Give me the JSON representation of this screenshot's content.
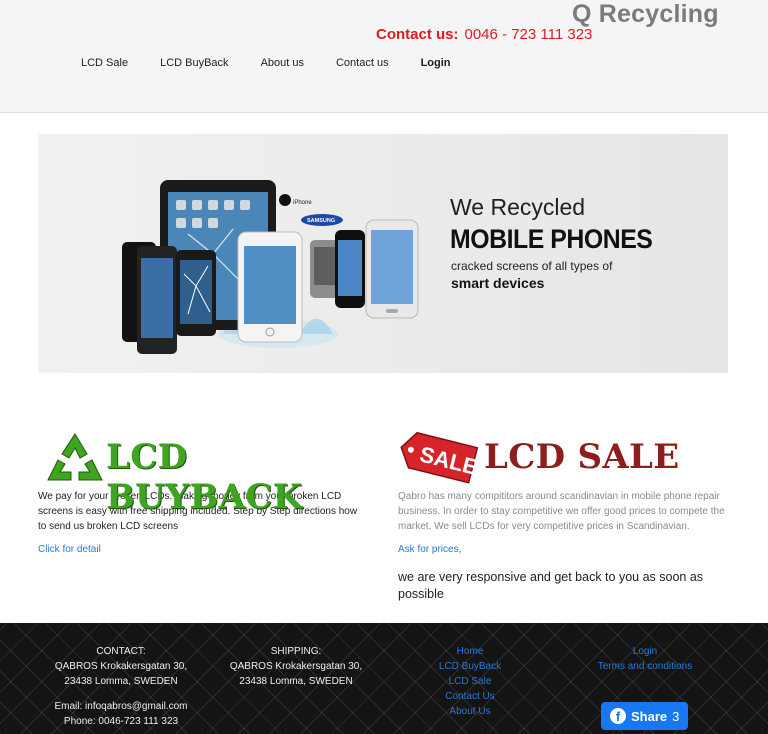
{
  "header": {
    "brand": "Q Recycling",
    "contact_label": "Contact us:",
    "contact_phone": "0046 - 723 111 323",
    "nav": [
      "LCD Sale",
      "LCD BuyBack",
      "About us",
      "Contact us",
      "Login"
    ]
  },
  "banner": {
    "line1": "We Recycled",
    "line2": "MOBILE PHONES",
    "line3": "cracked screens of all types of",
    "line4": "smart devices",
    "brand_iphone": "iPhone",
    "brand_samsung": "SAMSUNG"
  },
  "buyback": {
    "logo_text": "LCD BUYBACK",
    "description": "We pay for your broken LCDs. Making money from your broken LCD screens is easy with free shipping included. Step by Step directions how to send us broken LCD screens",
    "link": "Click for detail"
  },
  "sale": {
    "badge": "SALE",
    "logo_text": "LCD SALE",
    "description": "Qabro has many compititors around scandinavian in mobile phone repair business. In order to stay competitive we offer good prices to compete the market. We sell LCDs for very competitive prices in Scandinavian.",
    "link": "Ask for prices,",
    "note": "we are very responsive and get back to you as soon as possible"
  },
  "footer": {
    "contact": {
      "title": "CONTACT:",
      "line1": "QABROS Krokakersgatan 30,",
      "line2": "23438 Lomma, SWEDEN",
      "email": "Email: infoqabros@gmail.com",
      "phone": "Phone: 0046-723 111 323"
    },
    "shipping": {
      "title": "SHIPPING:",
      "line1": "QABROS Krokakersgatan 30,",
      "line2": "23438 Lomma, SWEDEN"
    },
    "links1": [
      "Home",
      "LCD BuyBack",
      "LCD Sale",
      "Contact Us",
      "About Us"
    ],
    "links2": [
      "Login",
      "Terms and conditions"
    ],
    "share_label": "Share",
    "share_count": "3"
  },
  "colors": {
    "accent_red": "#e01b22",
    "link_blue": "#2a7ad6",
    "buyback_green": "#3fa521",
    "sale_red": "#8e1d1d",
    "facebook_blue": "#1877f2"
  }
}
